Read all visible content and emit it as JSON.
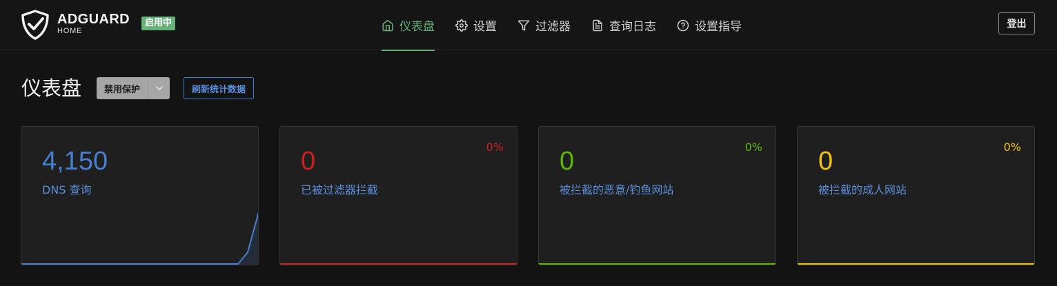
{
  "header": {
    "brand_name": "ADGUARD",
    "brand_sub": "HOME",
    "status_badge": "启用中",
    "nav": [
      {
        "label": "仪表盘",
        "icon": "home-icon",
        "active": true
      },
      {
        "label": "设置",
        "icon": "gear-icon",
        "active": false
      },
      {
        "label": "过滤器",
        "icon": "filter-icon",
        "active": false
      },
      {
        "label": "查询日志",
        "icon": "document-icon",
        "active": false
      },
      {
        "label": "设置指导",
        "icon": "help-circle-icon",
        "active": false
      }
    ],
    "logout_label": "登出"
  },
  "page": {
    "title": "仪表盘",
    "protect_button": "禁用保护",
    "refresh_button": "刷新统计数据"
  },
  "cards": [
    {
      "value": "4,150",
      "label": "DNS 查询",
      "percent": "",
      "color": "#467fcf",
      "has_chart": true
    },
    {
      "value": "0",
      "label": "已被过滤器拦截",
      "percent": "0%",
      "color": "#cd201f"
    },
    {
      "value": "0",
      "label": "被拦截的恶意/钓鱼网站",
      "percent": "0%",
      "color": "#5eba00"
    },
    {
      "value": "0",
      "label": "被拦截的成人网站",
      "percent": "0%",
      "color": "#f1c40f"
    }
  ],
  "colors": {
    "accent": "#67b279",
    "link": "#467fcf"
  }
}
